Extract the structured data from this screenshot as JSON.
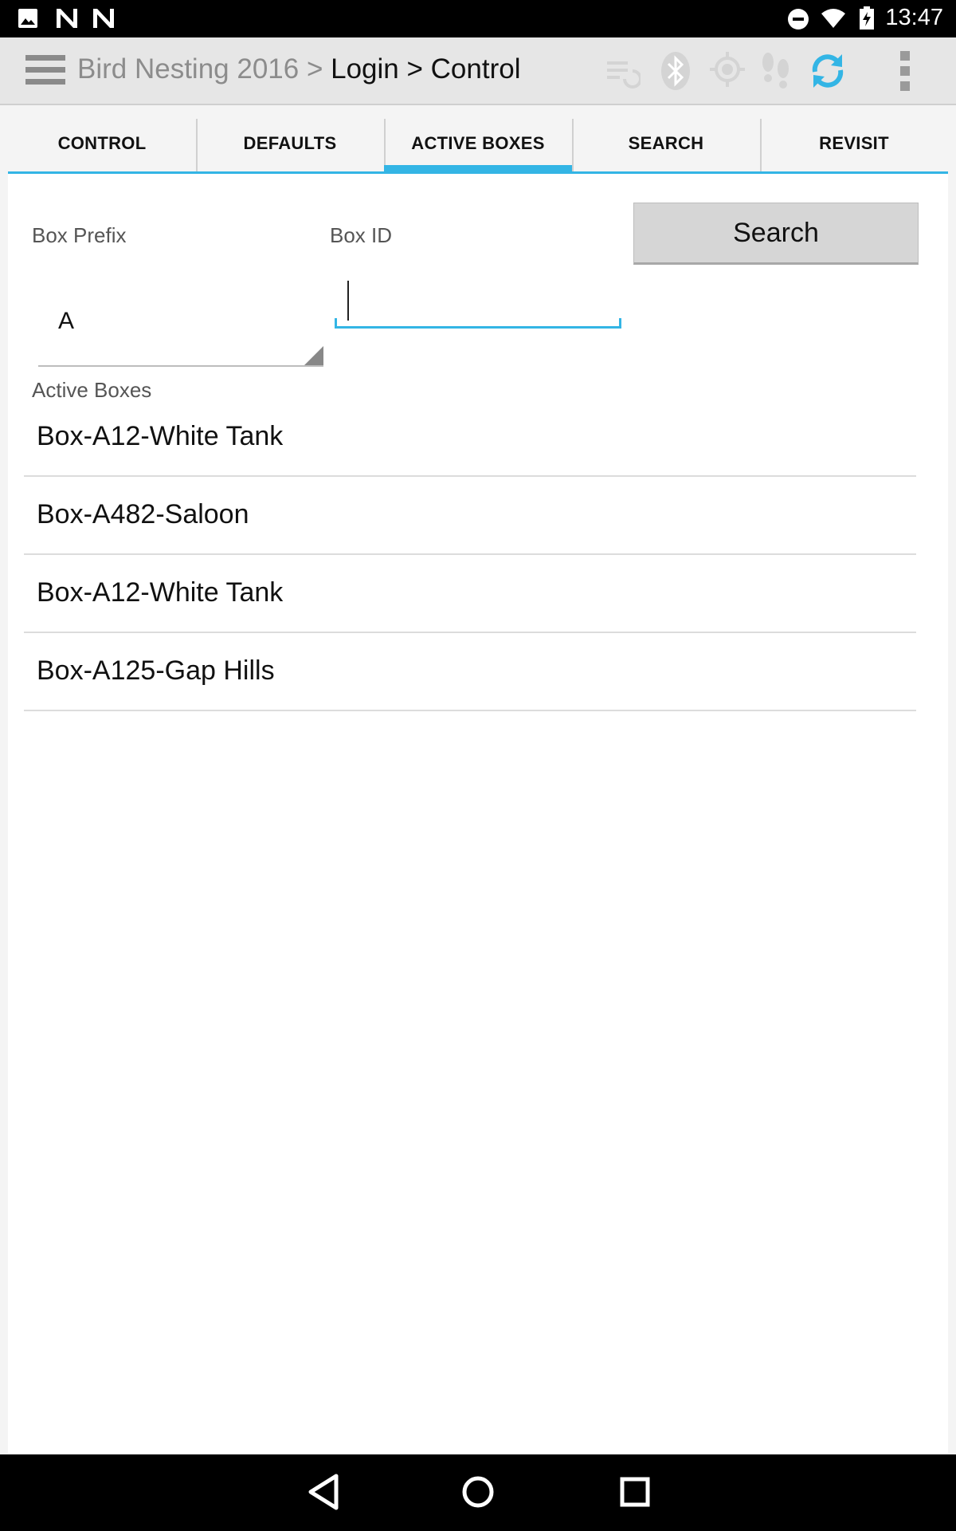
{
  "status_bar": {
    "time": "13:47"
  },
  "action_bar": {
    "breadcrumb_root": "Bird Nesting 2016 > ",
    "breadcrumb_current": "Login > Control",
    "sync_color": "#33b5e5"
  },
  "tabs": [
    {
      "label": "CONTROL",
      "active": false
    },
    {
      "label": "DEFAULTS",
      "active": false
    },
    {
      "label": "ACTIVE BOXES",
      "active": true
    },
    {
      "label": "SEARCH",
      "active": false
    },
    {
      "label": "REVISIT",
      "active": false
    }
  ],
  "form": {
    "box_prefix_label": "Box Prefix",
    "box_id_label": "Box ID",
    "search_button": "Search",
    "box_prefix_value": "A",
    "box_id_value": "",
    "box_id_placeholder": ""
  },
  "active_boxes": {
    "label": "Active Boxes",
    "items": [
      "Box-A12-White Tank",
      "Box-A482-Saloon",
      "Box-A12-White Tank",
      "Box-A125-Gap Hills"
    ]
  },
  "colors": {
    "accent": "#33b5e5"
  }
}
